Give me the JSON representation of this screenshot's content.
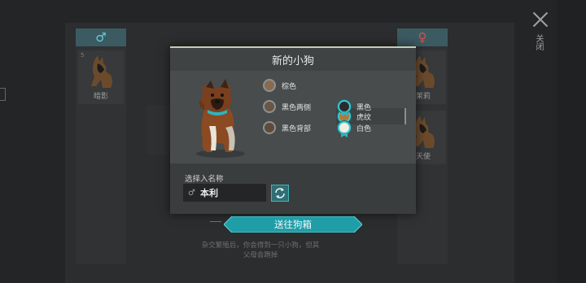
{
  "modal": {
    "title": "新的小狗",
    "colors": [
      {
        "label": "棕色",
        "swatch": "#8a6a4f",
        "selected": false
      },
      {
        "label": "虎纹",
        "swatch": "#b07a3a",
        "selected": true
      },
      {
        "label": "黑色两侧",
        "swatch": "#6a5646",
        "selected": false
      },
      {
        "label": "黑色",
        "swatch": "#2b2b2b",
        "selected": true
      },
      {
        "label": "黑色背部",
        "swatch": "#5f4a3b",
        "selected": false
      },
      {
        "label": "白色",
        "swatch": "#f1eee3",
        "selected": true
      }
    ],
    "name_label": "选择入名称",
    "name_value": "本利",
    "name_gender_symbol": "♂"
  },
  "cta": {
    "label": "送往狗箱",
    "accent": "#2fb4bd"
  },
  "background": {
    "male_symbol": "♂",
    "female_symbol": "♀",
    "left_dog_name": "暗影",
    "left_dog_number": "5",
    "right_dog_1_name": "茉莉",
    "right_dog_2_name": "天使",
    "note": "杂交繁殖后，你会得到一只小狗，但其父母会跑掉",
    "close_label": "关闭"
  }
}
